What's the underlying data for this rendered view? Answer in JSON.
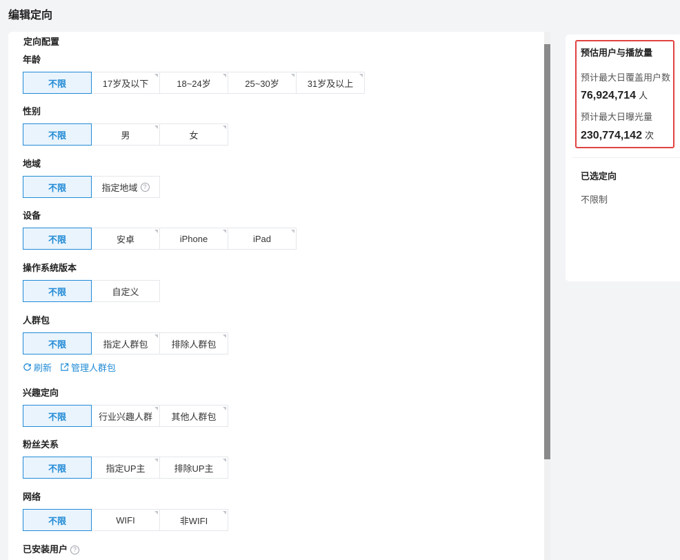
{
  "page": {
    "title": "编辑定向"
  },
  "config": {
    "section_title": "定向配置"
  },
  "groups": {
    "age": {
      "label": "年龄",
      "options": [
        "不限",
        "17岁及以下",
        "18~24岁",
        "25~30岁",
        "31岁及以上"
      ]
    },
    "gender": {
      "label": "性别",
      "options": [
        "不限",
        "男",
        "女"
      ]
    },
    "region": {
      "label": "地域",
      "options": [
        "不限",
        "指定地域"
      ]
    },
    "device": {
      "label": "设备",
      "options": [
        "不限",
        "安卓",
        "iPhone",
        "iPad"
      ]
    },
    "os": {
      "label": "操作系统版本",
      "options": [
        "不限",
        "自定义"
      ]
    },
    "audience": {
      "label": "人群包",
      "options": [
        "不限",
        "指定人群包",
        "排除人群包"
      ],
      "refresh": "刷新",
      "manage": "管理人群包"
    },
    "interest": {
      "label": "兴趣定向",
      "options": [
        "不限",
        "行业兴趣人群",
        "其他人群包"
      ]
    },
    "fans": {
      "label": "粉丝关系",
      "options": [
        "不限",
        "指定UP主",
        "排除UP主"
      ]
    },
    "network": {
      "label": "网络",
      "options": [
        "不限",
        "WIFI",
        "非WIFI"
      ]
    },
    "installed": {
      "label": "已安装用户"
    }
  },
  "estimate": {
    "title": "预估用户与播放量",
    "coverage_label": "预计最大日覆盖用户数",
    "coverage_value": "76,924,714",
    "coverage_unit": "人",
    "exposure_label": "预计最大日曝光量",
    "exposure_value": "230,774,142",
    "exposure_unit": "次"
  },
  "selected": {
    "title": "已选定向",
    "value": "不限制"
  },
  "colors": {
    "accent": "#1f8ad6",
    "highlight_border": "#e0413f"
  }
}
